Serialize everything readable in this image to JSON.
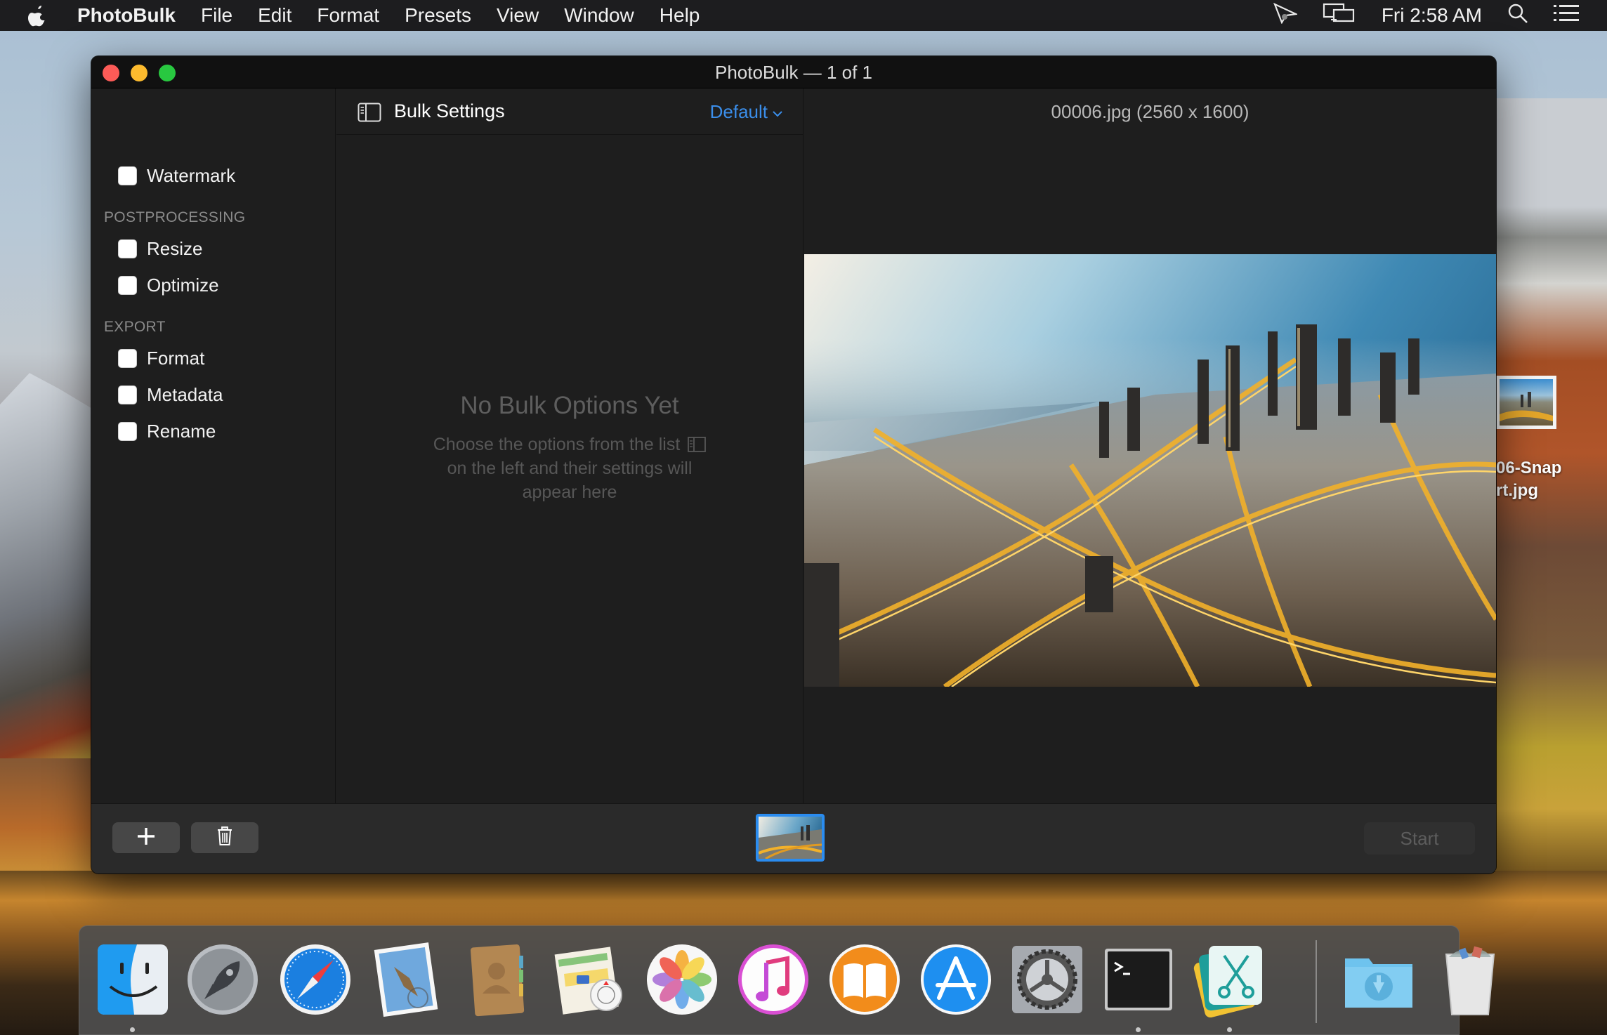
{
  "menubar": {
    "app_name": "PhotoBulk",
    "menus": [
      "File",
      "Edit",
      "Format",
      "Presets",
      "View",
      "Window",
      "Help"
    ],
    "clock": "Fri 2:58 AM",
    "status_icons": [
      "screenshot-tool-icon",
      "airplay-display-icon",
      "spotlight-search-icon",
      "notification-center-icon"
    ]
  },
  "window": {
    "title": "PhotoBulk — 1 of 1"
  },
  "sidebar": {
    "top_items": [
      {
        "label": "Watermark",
        "checked": false
      }
    ],
    "sections": [
      {
        "heading": "POSTPROCESSING",
        "items": [
          {
            "label": "Resize",
            "checked": false
          },
          {
            "label": "Optimize",
            "checked": false
          }
        ]
      },
      {
        "heading": "EXPORT",
        "items": [
          {
            "label": "Format",
            "checked": false
          },
          {
            "label": "Metadata",
            "checked": false
          },
          {
            "label": "Rename",
            "checked": false
          }
        ]
      }
    ]
  },
  "bulk_settings": {
    "title": "Bulk Settings",
    "preset": "Default",
    "empty_title": "No Bulk Options Yet",
    "empty_line1": "Choose the options from the list",
    "empty_line2": "on the left and their settings will",
    "empty_line3": "appear here"
  },
  "preview": {
    "file_info": "00006.jpg (2560 x 1600)"
  },
  "toolbar": {
    "add_label": "+",
    "start_label": "Start",
    "thumbnail_count": 1,
    "selected_thumbnail": 1
  },
  "desktop": {
    "file_label_line1": "06-Snap",
    "file_label_line2": "rt.jpg"
  },
  "dock": {
    "items": [
      {
        "name": "Finder",
        "running": true
      },
      {
        "name": "Launchpad",
        "running": false
      },
      {
        "name": "Safari",
        "running": false
      },
      {
        "name": "Mail",
        "running": false
      },
      {
        "name": "Contacts",
        "running": false
      },
      {
        "name": "Maps",
        "running": false
      },
      {
        "name": "Photos",
        "running": false
      },
      {
        "name": "iTunes",
        "running": false
      },
      {
        "name": "iBooks",
        "running": false
      },
      {
        "name": "App Store",
        "running": false
      },
      {
        "name": "System Preferences",
        "running": false
      },
      {
        "name": "Terminal",
        "running": true
      },
      {
        "name": "PhotoBulk",
        "running": true
      },
      {
        "name": "Downloads",
        "running": false
      },
      {
        "name": "Trash",
        "running": false
      }
    ]
  },
  "colors": {
    "accent": "#3b8eea",
    "selection": "#2a8cf0",
    "close": "#fc5b57",
    "minimize": "#fcbb2e",
    "maximize": "#28c840"
  }
}
